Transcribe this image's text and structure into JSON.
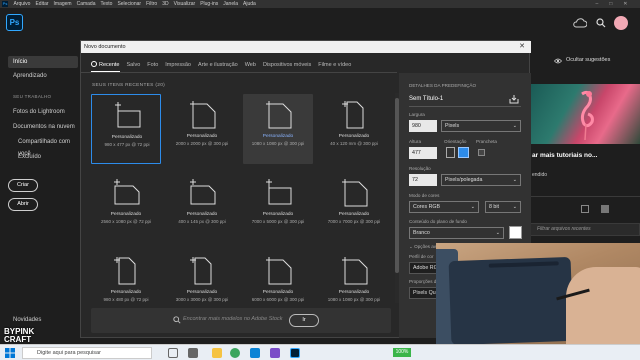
{
  "menubar": {
    "items": [
      "Arquivo",
      "Editar",
      "Imagem",
      "Camada",
      "Texto",
      "Selecionar",
      "Filtro",
      "3D",
      "Visualizar",
      "Plug-ins",
      "Janela",
      "Ajuda"
    ]
  },
  "app": {
    "logo": "Ps"
  },
  "sidebar": {
    "items": [
      {
        "label": "Início"
      },
      {
        "label": "Aprendizado"
      }
    ],
    "section_head": "SEU TRABALHO",
    "work_items": [
      {
        "label": "Fotos do Lightroom"
      },
      {
        "label": "Documentos na nuvem"
      },
      {
        "label": "Compartilhado com você"
      },
      {
        "label": "Excluído"
      }
    ],
    "create_label": "Criar",
    "open_label": "Abrir",
    "news_label": "Novidades"
  },
  "dialog": {
    "title": "Novo documento",
    "tabs": [
      "Recente",
      "Salvo",
      "Foto",
      "Impressão",
      "Arte e ilustração",
      "Web",
      "Dispositivos móveis",
      "Filme e vídeo"
    ],
    "recent_head": "SEUS ITENS RECENTES",
    "recent_count": "(20)",
    "tiles": [
      {
        "name": "Personalizado",
        "size": "980 x 477 px @ 72 ppi",
        "state": "selected",
        "shape": "landscape"
      },
      {
        "name": "Personalizado",
        "size": "2000 x 2000 px @ 300 ppi",
        "state": "",
        "shape": "square"
      },
      {
        "name": "Personalizado",
        "size": "1080 x 1080 px @ 300 ppi",
        "state": "hover",
        "shape": "square"
      },
      {
        "name": "Personalizado",
        "size": "40 x 120 mm @ 300 ppi",
        "state": "",
        "shape": "portrait"
      },
      {
        "name": "Personalizado",
        "size": "2560 x 1080 px @ 72 ppi",
        "state": "",
        "shape": "wide"
      },
      {
        "name": "Personalizado",
        "size": "400 x 145 px @ 300 ppi",
        "state": "",
        "shape": "wide"
      },
      {
        "name": "Personalizado",
        "size": "7000 x 5000 px @ 300 ppi",
        "state": "",
        "shape": "landscape"
      },
      {
        "name": "Personalizado",
        "size": "7000 x 7000 px @ 300 ppi",
        "state": "",
        "shape": "square"
      },
      {
        "name": "Personalizado",
        "size": "980 x 480 px @ 72 ppi",
        "state": "",
        "shape": "portrait"
      },
      {
        "name": "Personalizado",
        "size": "3000 x 3000 px @ 300 ppi",
        "state": "",
        "shape": "portrait"
      },
      {
        "name": "Personalizado",
        "size": "6000 x 6000 px @ 300 ppi",
        "state": "",
        "shape": "square"
      },
      {
        "name": "Personalizado",
        "size": "1080 x 1080 px @ 300 ppi",
        "state": "",
        "shape": "square"
      }
    ],
    "search_placeholder": "Encontrar mais modelos no Adobe Stock",
    "go_label": "Ir",
    "preset": {
      "heading": "DETALHES DA PREDEFINIÇÃO",
      "doc_name": "Sem Título-1",
      "width_label": "Largura",
      "width_value": "980",
      "width_unit": "Pixels",
      "height_label": "Altura",
      "height_value": "477",
      "orientation_label": "Orientação",
      "artboards_label": "Prancheta",
      "resolution_label": "Resolução",
      "resolution_value": "72",
      "resolution_unit": "Pixels/polegada",
      "color_mode_label": "Modo de cores",
      "color_mode_value": "Cores RGB",
      "bit_depth": "8 bit",
      "background_label": "Conteúdo do plano de fundo",
      "background_value": "Branco",
      "advanced_label": "Opções avançadas",
      "color_profile_label": "Perfil de cor",
      "color_profile_value": "Adobe RG",
      "pixel_ratio_label": "Proporções de pixel",
      "pixel_ratio_value": "Pixels Qu"
    }
  },
  "rightpane": {
    "hide_suggestions": "Ocultar sugestões",
    "card_title": "ar mais tutoriais no...",
    "card_sub": "endido",
    "filter_placeholder": "Filtrar arquivos recentes"
  },
  "webcam": {
    "watermark_line1": "BYPINK",
    "watermark_line2": "CRAFT"
  },
  "taskbar": {
    "search_placeholder": "Digite aqui para pesquisar",
    "battery": "100%"
  },
  "colors": {
    "accent": "#2d8ceb",
    "ps_blue": "#31a8ff",
    "ps_dark": "#001e36"
  }
}
